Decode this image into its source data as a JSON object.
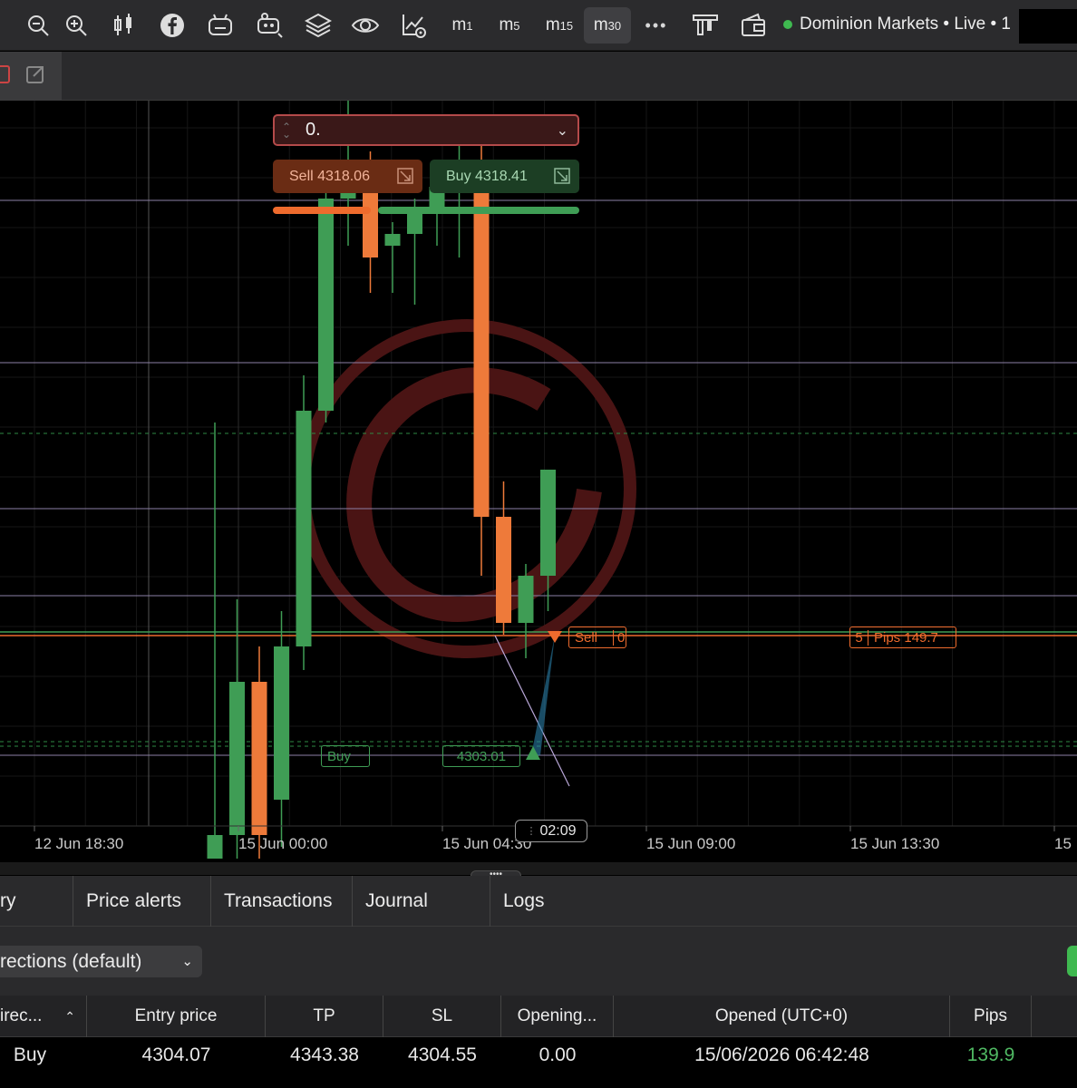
{
  "toolbar": {
    "icons": [
      "zoom-out-icon",
      "zoom-in-icon",
      "candlestick-icon",
      "facebook-icon",
      "bot-icon",
      "plugin-icon",
      "layers-icon",
      "eye-icon",
      "chart-settings-icon"
    ],
    "timeframes": [
      {
        "base": "m",
        "sub": "1"
      },
      {
        "base": "m",
        "sub": "5"
      },
      {
        "base": "m",
        "sub": "15"
      },
      {
        "base": "m",
        "sub": "30"
      }
    ],
    "more": "•••",
    "broker": "Dominion Markets • Live • 1"
  },
  "quick_trade": {
    "volume": "0.",
    "sell_label": "Sell 4318.06",
    "buy_label": "Buy 4318.41"
  },
  "chart_overlay": {
    "sell_tag": "Sell",
    "sell_tag_suffix": "0",
    "pips_prefix": "5",
    "pips_tag": "Pips 149.7",
    "buy_tag": "Buy",
    "entry_price_tag": "4303.01",
    "cursor_time": "02:09"
  },
  "chart_data": {
    "type": "candlestick",
    "x_ticks": [
      "12 Jun 18:30",
      "15 Jun 00:00",
      "15 Jun 04:30",
      "15 Jun 09:00",
      "15 Jun 13:30",
      "15"
    ],
    "candles": [
      {
        "o": 4285,
        "h": 4322,
        "l": 4285,
        "c": 4287,
        "dir": "up"
      },
      {
        "o": 4287,
        "h": 4307,
        "l": 4285,
        "c": 4300,
        "dir": "up"
      },
      {
        "o": 4300,
        "h": 4303,
        "l": 4285,
        "c": 4287,
        "dir": "down"
      },
      {
        "o": 4290,
        "h": 4306,
        "l": 4286,
        "c": 4303,
        "dir": "up"
      },
      {
        "o": 4303,
        "h": 4326,
        "l": 4301,
        "c": 4323,
        "dir": "up"
      },
      {
        "o": 4323,
        "h": 4344,
        "l": 4322,
        "c": 4341,
        "dir": "up"
      },
      {
        "o": 4341,
        "h": 4352,
        "l": 4337,
        "c": 4343,
        "dir": "up"
      },
      {
        "o": 4343,
        "h": 4345,
        "l": 4333,
        "c": 4336,
        "dir": "down"
      },
      {
        "o": 4337,
        "h": 4339,
        "l": 4333,
        "c": 4338,
        "dir": "up"
      },
      {
        "o": 4338,
        "h": 4341,
        "l": 4332,
        "c": 4340,
        "dir": "up"
      },
      {
        "o": 4340,
        "h": 4344,
        "l": 4337,
        "c": 4342,
        "dir": "up"
      },
      {
        "o": 4342,
        "h": 4346,
        "l": 4336,
        "c": 4344,
        "dir": "up"
      },
      {
        "o": 4344,
        "h": 4346,
        "l": 4309,
        "c": 4314,
        "dir": "down"
      },
      {
        "o": 4314,
        "h": 4317,
        "l": 4304,
        "c": 4305,
        "dir": "down"
      },
      {
        "o": 4305,
        "h": 4310,
        "l": 4302,
        "c": 4309,
        "dir": "up"
      },
      {
        "o": 4309,
        "h": 4318,
        "l": 4306,
        "c": 4318,
        "dir": "up"
      }
    ]
  },
  "bottom": {
    "tabs": [
      "ry",
      "Price alerts",
      "Transactions",
      "Journal",
      "Logs"
    ],
    "filter": "rections (default)",
    "columns": [
      "irec...",
      "Entry price",
      "TP",
      "SL",
      "Opening...",
      "Opened (UTC+0)",
      "Pips"
    ],
    "row": {
      "direction": "Buy",
      "entry": "4304.07",
      "tp": "4343.38",
      "sl": "4304.55",
      "opening": "0.00",
      "opened": "15/06/2026 06:42:48",
      "pips": "139.9"
    }
  },
  "colors": {
    "up": "#3f9d55",
    "down": "#ee7a3a",
    "pips_positive": "#4fb862"
  }
}
